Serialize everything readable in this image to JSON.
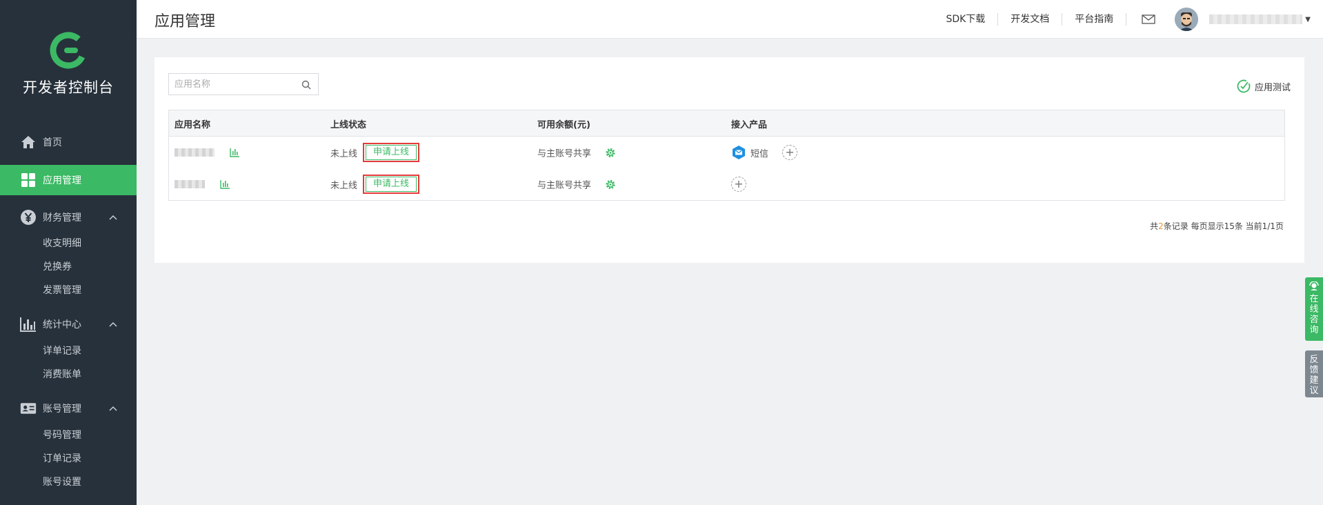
{
  "app": {
    "console_title": "开发者控制台",
    "page_title": "应用管理"
  },
  "colors": {
    "sidebar_bg": "#27313b",
    "accent_green": "#3bb964",
    "highlight_red": "#e33a3a",
    "page_bg": "#f0f1f3"
  },
  "sidebar": {
    "items": [
      {
        "label": "首页",
        "icon": "home-icon",
        "active": false
      },
      {
        "label": "应用管理",
        "icon": "apps-grid-icon",
        "active": true
      },
      {
        "label": "财务管理",
        "icon": "yuan-icon",
        "expanded": true,
        "children": [
          "收支明细",
          "兑换券",
          "发票管理"
        ]
      },
      {
        "label": "统计中心",
        "icon": "bar-chart-icon",
        "expanded": true,
        "children": [
          "详单记录",
          "消费账单"
        ]
      },
      {
        "label": "账号管理",
        "icon": "id-card-icon",
        "expanded": true,
        "children": [
          "号码管理",
          "订单记录",
          "账号设置"
        ]
      }
    ]
  },
  "topbar": {
    "links": [
      "SDK下载",
      "开发文档",
      "平台指南"
    ],
    "mail_icon": "mail-icon",
    "avatar_icon": "avatar-icon"
  },
  "main": {
    "search_placeholder": "应用名称",
    "app_test_label": "应用测试",
    "table": {
      "headers": [
        "应用名称",
        "上线状态",
        "可用余额(元)",
        "接入产品"
      ],
      "rows": [
        {
          "status": "未上线",
          "apply_label": "申请上线",
          "balance": "与主账号共享",
          "products": [
            "短信"
          ]
        },
        {
          "status": "未上线",
          "apply_label": "申请上线",
          "balance": "与主账号共享",
          "products": []
        }
      ]
    },
    "pager": {
      "prefix": "共",
      "count": "2",
      "suffix": "条记录 每页显示15条 当前1/1页"
    }
  },
  "float": {
    "consult": [
      "在",
      "线",
      "咨",
      "询"
    ],
    "feedback": [
      "反",
      "馈",
      "建",
      "议"
    ]
  }
}
